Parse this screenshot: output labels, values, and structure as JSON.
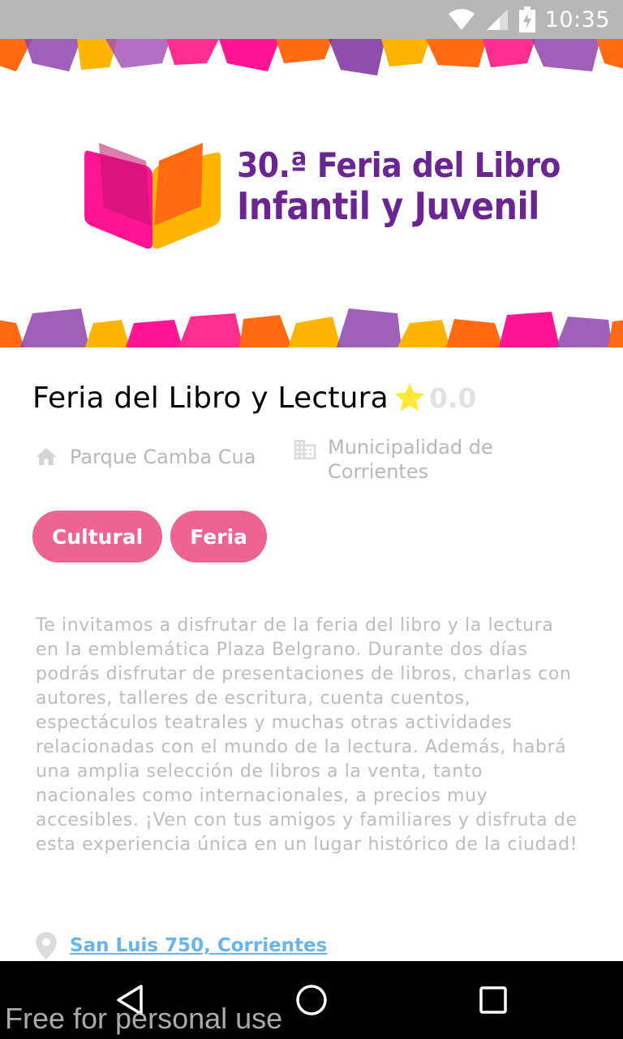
{
  "status_bar": {
    "time": "10:35"
  },
  "banner": {
    "logo_line1": "30.ª Feria del Libro",
    "logo_line2": "Infantil y Juvenil",
    "colors": {
      "purple": "#6a2592",
      "magenta": "#ff1493",
      "orange": "#ff6a13",
      "yellow": "#ffb400",
      "pink": "#f03a9a"
    }
  },
  "event": {
    "title": "Feria del Libro y Lectura",
    "rating": "0.0",
    "place": "Parque Camba Cua",
    "organizer": "Municipalidad de Corrientes",
    "tags": [
      "Cultural",
      "Feria"
    ],
    "description": "Te invitamos a disfrutar de la feria del libro y la lectura en la emblemática Plaza Belgrano. Durante dos días podrás disfrutar de presentaciones de libros, charlas con autores, talleres de escritura, cuenta cuentos, espectáculos teatrales y muchas otras actividades relacionadas con el mundo de la lectura. Además, habrá una amplia selección de libros a la venta, tanto nacionales como internacionales, a precios muy accesibles. ¡Ven con tus amigos y familiares y disfruta de esta experiencia única en un lugar histórico de la ciudad!",
    "address": "San Luis 750, Corrientes"
  },
  "theme": {
    "tag_color": "#ef6390",
    "star_color": "#ffe83a",
    "link_color": "#69b4ea"
  },
  "watermark": "Free for personal use"
}
